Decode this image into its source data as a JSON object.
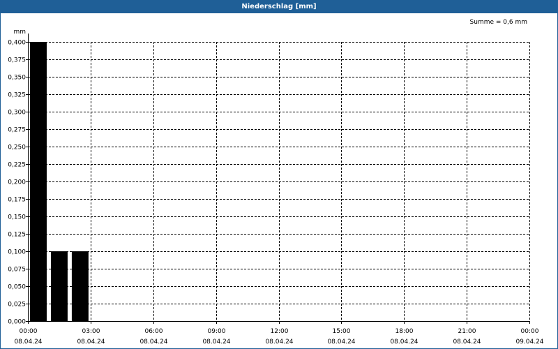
{
  "chart_data": {
    "type": "bar",
    "title": "Niederschlag [mm]",
    "ylabel": "mm",
    "summary": "Summe = 0,6 mm",
    "ylim": [
      0,
      0.4
    ],
    "y_ticks": [
      "0,000",
      "0,025",
      "0,050",
      "0,075",
      "0,100",
      "0,125",
      "0,150",
      "0,175",
      "0,200",
      "0,225",
      "0,250",
      "0,275",
      "0,300",
      "0,325",
      "0,350",
      "0,375",
      "0,400"
    ],
    "x_ticks": [
      {
        "time": "00:00",
        "date": "08.04.24"
      },
      {
        "time": "03:00",
        "date": "08.04.24"
      },
      {
        "time": "06:00",
        "date": "08.04.24"
      },
      {
        "time": "09:00",
        "date": "08.04.24"
      },
      {
        "time": "12:00",
        "date": "08.04.24"
      },
      {
        "time": "15:00",
        "date": "08.04.24"
      },
      {
        "time": "18:00",
        "date": "08.04.24"
      },
      {
        "time": "21:00",
        "date": "08.04.24"
      },
      {
        "time": "00:00",
        "date": "09.04.24"
      }
    ],
    "x_range_hours": [
      0,
      24
    ],
    "bars": [
      {
        "start_hour": 0,
        "end_hour": 1,
        "value": 0.4
      },
      {
        "start_hour": 1,
        "end_hour": 2,
        "value": 0.1
      },
      {
        "start_hour": 2,
        "end_hour": 3,
        "value": 0.1
      }
    ],
    "bar_color": "#000000",
    "grid": true
  }
}
